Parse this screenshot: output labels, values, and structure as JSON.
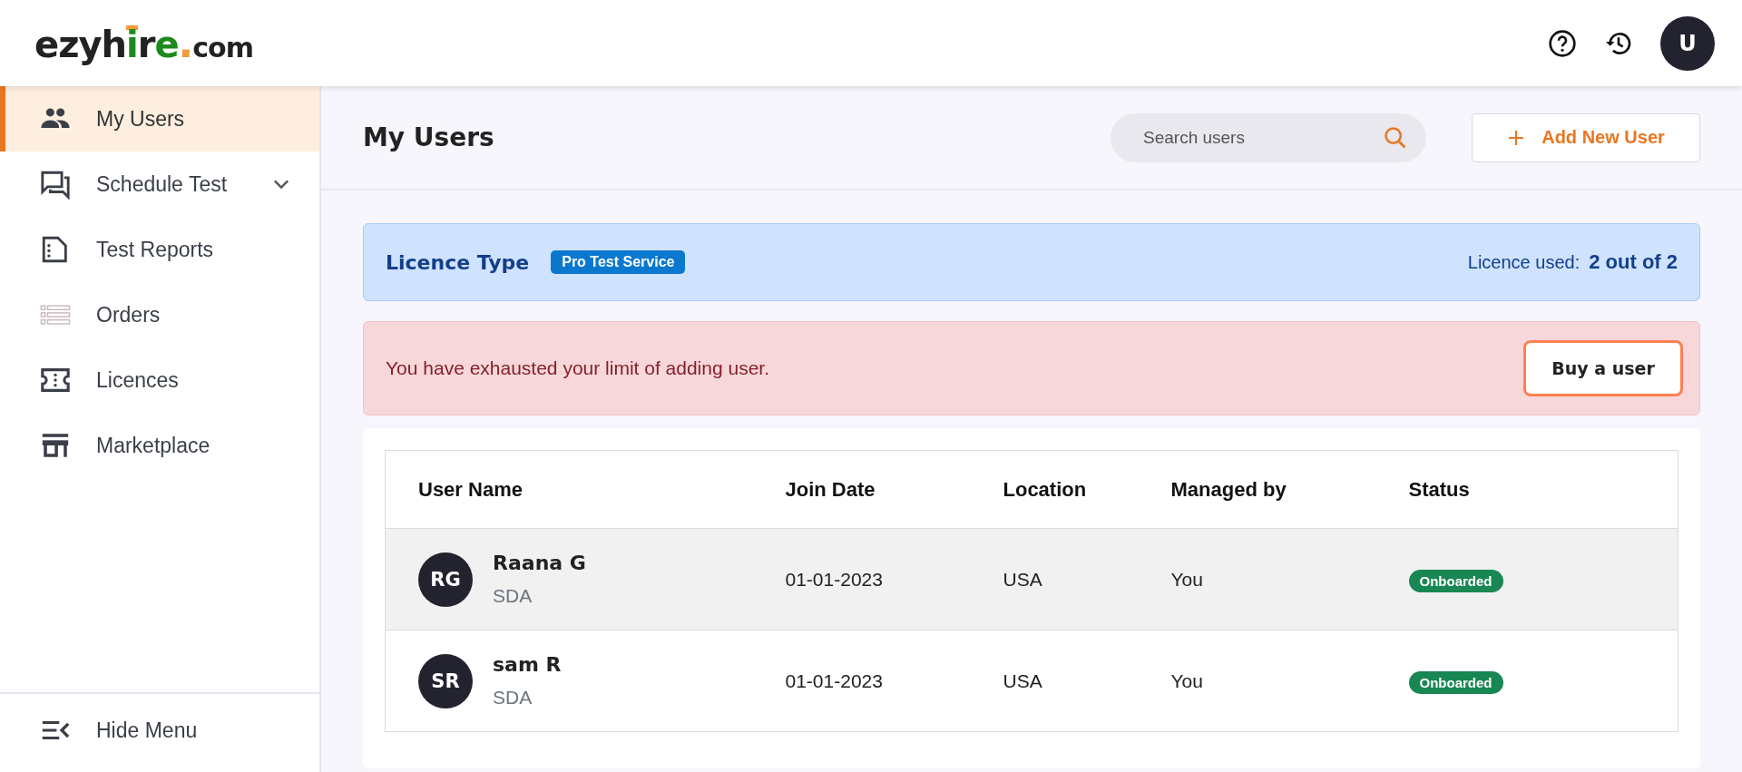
{
  "logo": {
    "part_1": "ezyh",
    "part_2": "i",
    "part_3": "r",
    "part_4": "e",
    "part_5": ".",
    "part_6": "com"
  },
  "header": {
    "avatar": "U"
  },
  "sidebar": {
    "items": [
      {
        "label": "My Users",
        "selected": true,
        "expandable": false
      },
      {
        "label": "Schedule Test",
        "selected": false,
        "expandable": true
      },
      {
        "label": "Test Reports",
        "selected": false,
        "expandable": false
      },
      {
        "label": "Orders",
        "selected": false,
        "expandable": false
      },
      {
        "label": "Licences",
        "selected": false,
        "expandable": false
      },
      {
        "label": "Marketplace",
        "selected": false,
        "expandable": false
      }
    ],
    "footer": "Hide Menu"
  },
  "page": {
    "title": "My Users",
    "search": {
      "placeholder": "Search users"
    },
    "add_button": "Add New User"
  },
  "licence": {
    "label": "Licence Type",
    "badge": "Pro Test Service",
    "used_label": "Licence used:",
    "used_value": "2 out of 2"
  },
  "alert": {
    "message": "You have exhausted your limit of adding user.",
    "button": "Buy a user"
  },
  "table": {
    "columns": [
      "User Name",
      "Join Date",
      "Location",
      "Managed by",
      "Status"
    ],
    "rows": [
      {
        "initials": "RG",
        "name": "Raana G",
        "role": "SDA",
        "join_date": "01-01-2023",
        "location": "USA",
        "managed_by": "You",
        "status": "Onboarded",
        "selected": true
      },
      {
        "initials": "SR",
        "name": "sam R",
        "role": "SDA",
        "join_date": "01-01-2023",
        "location": "USA",
        "managed_by": "You",
        "status": "Onboarded",
        "selected": false
      }
    ]
  }
}
